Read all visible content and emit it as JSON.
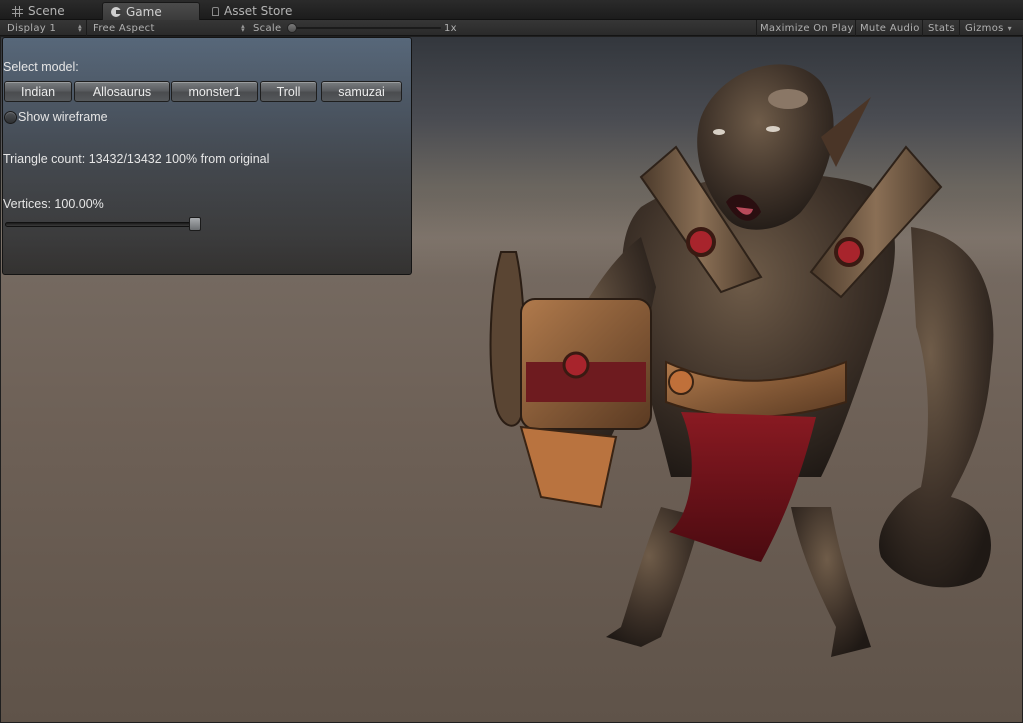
{
  "tabs": {
    "scene": {
      "label": "Scene",
      "icon": "scene-grid-icon"
    },
    "game": {
      "label": "Game",
      "icon": "game-pacman-icon"
    },
    "store": {
      "label": "Asset Store",
      "icon": "store-bag-icon"
    }
  },
  "toolbar": {
    "display": "Display 1",
    "aspect": "Free Aspect",
    "scale_label": "Scale",
    "scale_value": "1x",
    "maximize": "Maximize On Play",
    "mute": "Mute Audio",
    "stats": "Stats",
    "gizmos": "Gizmos"
  },
  "panel": {
    "select_label": "Select model:",
    "models": [
      "Indian",
      "Allosaurus",
      "monster1",
      "Troll",
      "samuzai"
    ],
    "wireframe_label": "Show wireframe",
    "triangle_text": "Triangle count: 13432/13432 100% from original",
    "vertices_text": "Vertices: 100.00%",
    "vertices_fraction": 1.0
  },
  "viewport": {
    "subject": "troll-creature-model"
  },
  "colors": {
    "accent_panel": "#5f7287",
    "background": "#1f1f1f"
  }
}
